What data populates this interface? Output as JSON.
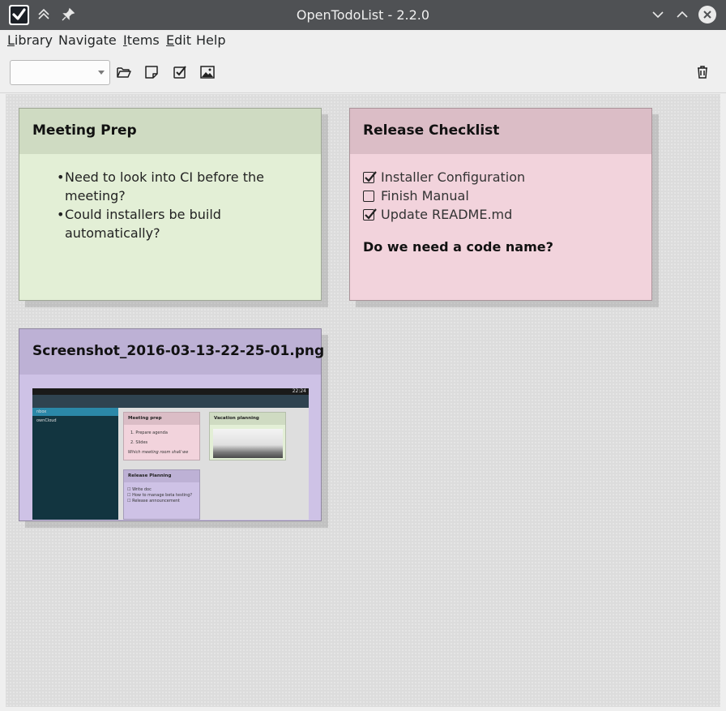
{
  "window": {
    "title": "OpenTodoList - 2.2.0"
  },
  "menubar": {
    "items": [
      {
        "mnemonic": "L",
        "rest": "ibrary"
      },
      {
        "mnemonic": "",
        "rest": "Navigate"
      },
      {
        "mnemonic": "I",
        "rest": "tems"
      },
      {
        "mnemonic": "E",
        "rest": "dit"
      },
      {
        "mnemonic": "",
        "rest": "Help"
      }
    ]
  },
  "toolbar": {
    "combo_value": "",
    "icons": [
      "folder-open-icon",
      "note-icon",
      "checklist-icon",
      "image-icon",
      "trash-icon"
    ]
  },
  "cards": {
    "meeting": {
      "title": "Meeting Prep",
      "lines": [
        "Need to look into CI before the",
        "meeting?",
        "Could installers be build",
        "automatically?"
      ],
      "bullet": "•"
    },
    "release": {
      "title": "Release Checklist",
      "tasks": [
        {
          "label": "Installer Configuration",
          "done": true
        },
        {
          "label": "Finish Manual",
          "done": false
        },
        {
          "label": "Update README.md",
          "done": true
        }
      ],
      "note": "Do we need a code name?"
    },
    "image": {
      "title": "Screenshot_2016-03-13-22-25-01.png",
      "thumbnail": {
        "clock": "22:24",
        "sidebar": [
          "nbox",
          "ownCloud"
        ],
        "meeting": {
          "title": "Meeting prep",
          "lines": [
            "1. Prepare agenda",
            "2. Slides",
            "Which meeting room shall we"
          ]
        },
        "vacation": {
          "title": "Vacation planning"
        },
        "release": {
          "title": "Release Planning",
          "lines": [
            "☐ Write doc",
            "☐ How to manage beta testing?",
            "☐ Release announcement"
          ]
        }
      }
    }
  },
  "colors": {
    "titlebar": "#4f5154",
    "card_green": "#e3efd6",
    "card_pink": "#f2d3dc",
    "card_purple": "#cec2e6"
  }
}
